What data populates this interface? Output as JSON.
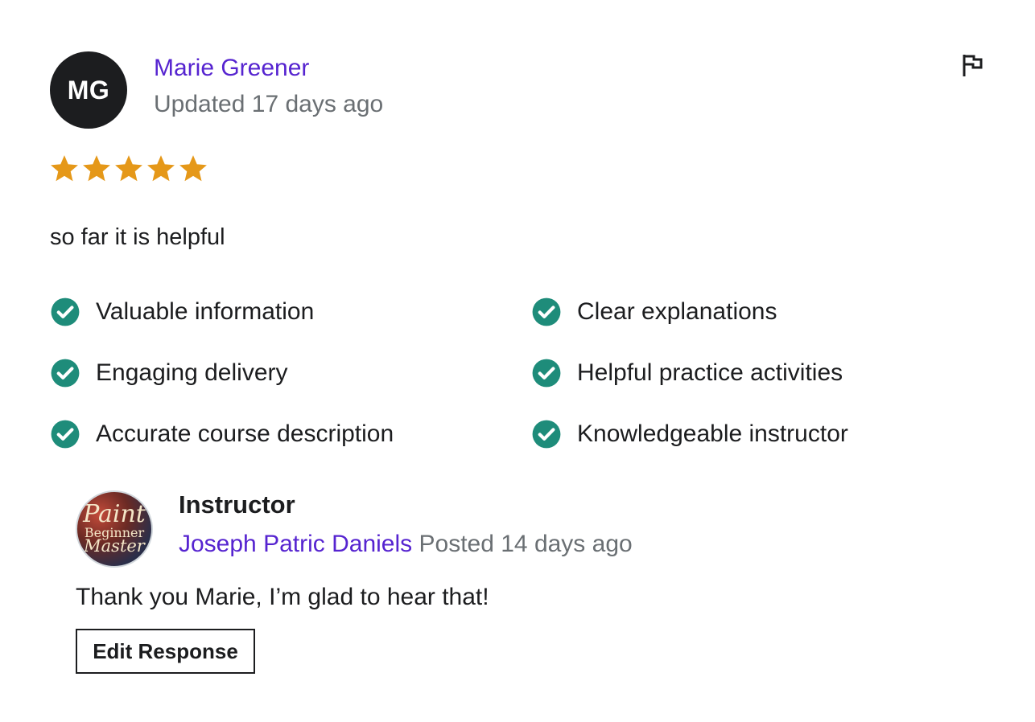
{
  "review": {
    "avatar_initials": "MG",
    "reviewer_name": "Marie Greener",
    "date": "Updated 17 days ago",
    "rating": 5,
    "rating_max": 5,
    "text": "so far it is helpful",
    "tags": [
      "Valuable information",
      "Clear explanations",
      "Engaging delivery",
      "Helpful practice activities",
      "Accurate course description",
      "Knowledgeable instructor"
    ]
  },
  "response": {
    "avatar_lines": [
      "Paint",
      "Beginner",
      "Master"
    ],
    "role_label": "Instructor",
    "responder_name": "Joseph Patric Daniels",
    "posted": "Posted 14 days ago",
    "text": "Thank you Marie, I’m glad to hear that!",
    "edit_button_label": "Edit Response"
  },
  "icons": {
    "report": "flag-icon",
    "star": "star-icon",
    "check": "check-circle-icon"
  },
  "colors": {
    "star": "#e59819",
    "check": "#1e8c7a",
    "link": "#5624d0",
    "muted": "#6a6f73",
    "text": "#1c1d1f"
  }
}
